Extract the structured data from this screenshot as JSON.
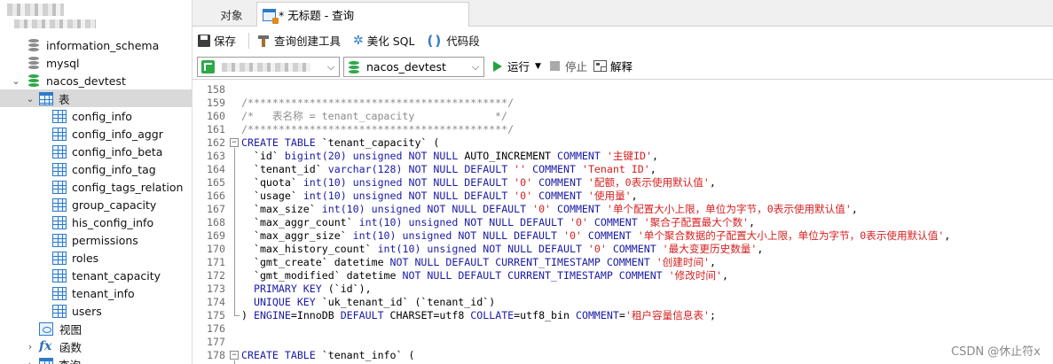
{
  "sidebar": {
    "databases": [
      {
        "name": "information_schema"
      },
      {
        "name": "mysql"
      },
      {
        "name": "nacos_devtest"
      }
    ],
    "tables_node": "表",
    "tables": [
      "config_info",
      "config_info_aggr",
      "config_info_beta",
      "config_info_tag",
      "config_tags_relation",
      "group_capacity",
      "his_config_info",
      "permissions",
      "roles",
      "tenant_capacity",
      "tenant_info",
      "users"
    ],
    "views_node": "视图",
    "functions_node": "函数",
    "queries_node": "查询"
  },
  "tabs": {
    "objects": "对象",
    "query": "* 无标题 - 查询"
  },
  "toolbar": {
    "save": "保存",
    "query_builder": "查询创建工具",
    "beautify": "美化 SQL",
    "snippet": "代码段",
    "database": "nacos_devtest",
    "run": "运行",
    "stop": "停止",
    "explain": "解释"
  },
  "editor": {
    "lines": [
      {
        "n": "158",
        "segs": []
      },
      {
        "n": "159",
        "segs": [
          {
            "t": "/******************************************/",
            "c": "c-com"
          }
        ]
      },
      {
        "n": "160",
        "segs": [
          {
            "t": "/*   表名称 = tenant_capacity             */",
            "c": "c-com"
          }
        ]
      },
      {
        "n": "161",
        "segs": [
          {
            "t": "/******************************************/",
            "c": "c-com"
          }
        ]
      },
      {
        "n": "162",
        "fold": "start",
        "segs": [
          {
            "t": "CREATE TABLE ",
            "c": "c-kw"
          },
          {
            "t": "`tenant_capacity` (",
            "c": "c-id"
          }
        ]
      },
      {
        "n": "163",
        "segs": [
          {
            "t": "  `id` ",
            "c": "c-id"
          },
          {
            "t": "bigint",
            "c": "c-kw"
          },
          {
            "t": "(20) ",
            "c": "c-num"
          },
          {
            "t": "unsigned NOT NULL ",
            "c": "c-kw"
          },
          {
            "t": "AUTO_INCREMENT ",
            "c": "c-id"
          },
          {
            "t": "COMMENT ",
            "c": "c-kw"
          },
          {
            "t": "'主键ID'",
            "c": "c-str"
          },
          {
            "t": ",",
            "c": "c-id"
          }
        ]
      },
      {
        "n": "164",
        "segs": [
          {
            "t": "  `tenant_id` ",
            "c": "c-id"
          },
          {
            "t": "varchar",
            "c": "c-kw"
          },
          {
            "t": "(128) ",
            "c": "c-num"
          },
          {
            "t": "NOT NULL DEFAULT ",
            "c": "c-kw"
          },
          {
            "t": "'' ",
            "c": "c-str"
          },
          {
            "t": "COMMENT ",
            "c": "c-kw"
          },
          {
            "t": "'Tenant ID'",
            "c": "c-str"
          },
          {
            "t": ",",
            "c": "c-id"
          }
        ]
      },
      {
        "n": "165",
        "segs": [
          {
            "t": "  `quota` ",
            "c": "c-id"
          },
          {
            "t": "int",
            "c": "c-kw"
          },
          {
            "t": "(10) ",
            "c": "c-num"
          },
          {
            "t": "unsigned NOT NULL DEFAULT ",
            "c": "c-kw"
          },
          {
            "t": "'0' ",
            "c": "c-str"
          },
          {
            "t": "COMMENT ",
            "c": "c-kw"
          },
          {
            "t": "'配额，0表示使用默认值'",
            "c": "c-str"
          },
          {
            "t": ",",
            "c": "c-id"
          }
        ]
      },
      {
        "n": "166",
        "segs": [
          {
            "t": "  `usage` ",
            "c": "c-id"
          },
          {
            "t": "int",
            "c": "c-kw"
          },
          {
            "t": "(10) ",
            "c": "c-num"
          },
          {
            "t": "unsigned NOT NULL DEFAULT ",
            "c": "c-kw"
          },
          {
            "t": "'0' ",
            "c": "c-str"
          },
          {
            "t": "COMMENT ",
            "c": "c-kw"
          },
          {
            "t": "'使用量'",
            "c": "c-str"
          },
          {
            "t": ",",
            "c": "c-id"
          }
        ]
      },
      {
        "n": "167",
        "segs": [
          {
            "t": "  `max_size` ",
            "c": "c-id"
          },
          {
            "t": "int",
            "c": "c-kw"
          },
          {
            "t": "(10) ",
            "c": "c-num"
          },
          {
            "t": "unsigned NOT NULL DEFAULT ",
            "c": "c-kw"
          },
          {
            "t": "'0' ",
            "c": "c-str"
          },
          {
            "t": "COMMENT ",
            "c": "c-kw"
          },
          {
            "t": "'单个配置大小上限，单位为字节，0表示使用默认值'",
            "c": "c-str"
          },
          {
            "t": ",",
            "c": "c-id"
          }
        ]
      },
      {
        "n": "168",
        "segs": [
          {
            "t": "  `max_aggr_count` ",
            "c": "c-id"
          },
          {
            "t": "int",
            "c": "c-kw"
          },
          {
            "t": "(10) ",
            "c": "c-num"
          },
          {
            "t": "unsigned NOT NULL DEFAULT ",
            "c": "c-kw"
          },
          {
            "t": "'0' ",
            "c": "c-str"
          },
          {
            "t": "COMMENT ",
            "c": "c-kw"
          },
          {
            "t": "'聚合子配置最大个数'",
            "c": "c-str"
          },
          {
            "t": ",",
            "c": "c-id"
          }
        ]
      },
      {
        "n": "169",
        "segs": [
          {
            "t": "  `max_aggr_size` ",
            "c": "c-id"
          },
          {
            "t": "int",
            "c": "c-kw"
          },
          {
            "t": "(10) ",
            "c": "c-num"
          },
          {
            "t": "unsigned NOT NULL DEFAULT ",
            "c": "c-kw"
          },
          {
            "t": "'0' ",
            "c": "c-str"
          },
          {
            "t": "COMMENT ",
            "c": "c-kw"
          },
          {
            "t": "'单个聚合数据的子配置大小上限，单位为字节，0表示使用默认值'",
            "c": "c-str"
          },
          {
            "t": ",",
            "c": "c-id"
          }
        ]
      },
      {
        "n": "170",
        "segs": [
          {
            "t": "  `max_history_count` ",
            "c": "c-id"
          },
          {
            "t": "int",
            "c": "c-kw"
          },
          {
            "t": "(10) ",
            "c": "c-num"
          },
          {
            "t": "unsigned NOT NULL DEFAULT ",
            "c": "c-kw"
          },
          {
            "t": "'0' ",
            "c": "c-str"
          },
          {
            "t": "COMMENT ",
            "c": "c-kw"
          },
          {
            "t": "'最大变更历史数量'",
            "c": "c-str"
          },
          {
            "t": ",",
            "c": "c-id"
          }
        ]
      },
      {
        "n": "171",
        "segs": [
          {
            "t": "  `gmt_create` ",
            "c": "c-id"
          },
          {
            "t": "datetime ",
            "c": "c-id"
          },
          {
            "t": "NOT NULL DEFAULT CURRENT_TIMESTAMP COMMENT ",
            "c": "c-kw"
          },
          {
            "t": "'创建时间'",
            "c": "c-str"
          },
          {
            "t": ",",
            "c": "c-id"
          }
        ]
      },
      {
        "n": "172",
        "segs": [
          {
            "t": "  `gmt_modified` ",
            "c": "c-id"
          },
          {
            "t": "datetime ",
            "c": "c-id"
          },
          {
            "t": "NOT NULL DEFAULT CURRENT_TIMESTAMP COMMENT ",
            "c": "c-kw"
          },
          {
            "t": "'修改时间'",
            "c": "c-str"
          },
          {
            "t": ",",
            "c": "c-id"
          }
        ]
      },
      {
        "n": "173",
        "segs": [
          {
            "t": "  PRIMARY KEY ",
            "c": "c-kw"
          },
          {
            "t": "(`id`),",
            "c": "c-id"
          }
        ]
      },
      {
        "n": "174",
        "segs": [
          {
            "t": "  UNIQUE KEY ",
            "c": "c-kw"
          },
          {
            "t": "`uk_tenant_id` (`tenant_id`)",
            "c": "c-id"
          }
        ]
      },
      {
        "n": "175",
        "fold": "end",
        "segs": [
          {
            "t": ") ",
            "c": "c-id"
          },
          {
            "t": "ENGINE",
            "c": "c-kw"
          },
          {
            "t": "=InnoDB ",
            "c": "c-id"
          },
          {
            "t": "DEFAULT ",
            "c": "c-kw"
          },
          {
            "t": "CHARSET=utf8 ",
            "c": "c-id"
          },
          {
            "t": "COLLATE",
            "c": "c-kw"
          },
          {
            "t": "=utf8_bin ",
            "c": "c-id"
          },
          {
            "t": "COMMENT",
            "c": "c-kw"
          },
          {
            "t": "=",
            "c": "c-id"
          },
          {
            "t": "'租户容量信息表'",
            "c": "c-str"
          },
          {
            "t": ";",
            "c": "c-id"
          }
        ]
      },
      {
        "n": "176",
        "segs": []
      },
      {
        "n": "177",
        "segs": []
      },
      {
        "n": "178",
        "fold": "start",
        "segs": [
          {
            "t": "CREATE TABLE ",
            "c": "c-kw"
          },
          {
            "t": "`tenant_info` (",
            "c": "c-id"
          }
        ]
      }
    ]
  },
  "watermark": "CSDN @休止符x"
}
